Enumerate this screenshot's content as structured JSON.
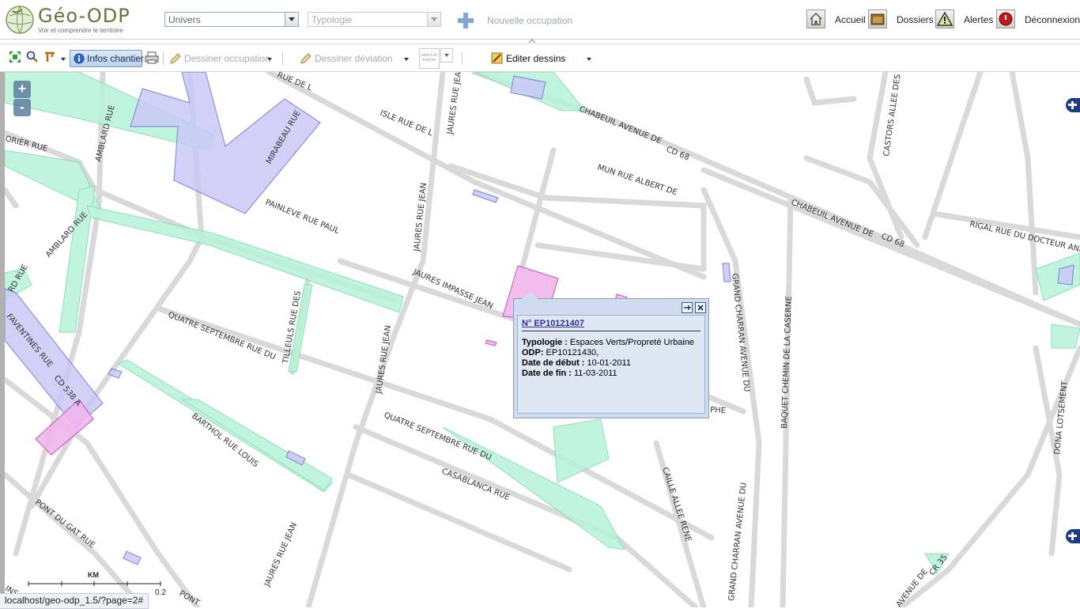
{
  "header": {
    "logo_name": "Géo-ODP",
    "logo_tagline": "Voir et comprendre le territoire",
    "univers_select": "Univers",
    "typologie_select": "Typologie",
    "new_occupation": "Nouvelle occupation",
    "nav": [
      {
        "label": "Accueil",
        "icon": "home-icon"
      },
      {
        "label": "Dossiers",
        "icon": "folder-icon"
      },
      {
        "label": "Alertes",
        "icon": "alert-icon"
      },
      {
        "label": "Déconnexion",
        "icon": "power-icon"
      }
    ]
  },
  "toolbar": {
    "infos_chantier": "Infos chantier",
    "dessiner_occupation": "Dessiner occupation",
    "dessiner_deviation": "Dessiner déviation",
    "select_line": "select un tronçon",
    "editer_dessins": "Editer dessins"
  },
  "map": {
    "zoom_in": "+",
    "zoom_out": "-",
    "street_labels": [
      "RUE DE L",
      "ISLE RUE DE L",
      "JAURES RUE JEAN",
      "CHABEUIL AVENUE DE",
      "CD 68",
      "MUN RUE ALBERT DE",
      "CASTORS ALLEE DES",
      "CHABEUIL AVENUE DE",
      "CD 68",
      "RIGAL RUE DU DOCTEUR AND",
      "ORIER RUE",
      "AMBLARD RUE",
      "MIRABEAU RUE",
      "JAURES RUE JEAN",
      "PAINLEVE RUE PAUL",
      "AMBLARD RUE",
      "RD RUE",
      "JAURES IMPASSE JEAN",
      "GRAND CHARRAN AVENUE DU",
      "BAQUET CHEMIN DE LA CASERNE",
      "FAVENTINES RUE",
      "CD 538 A",
      "TILLEULS RUE DES",
      "QUATRE SEPTEMBRE RUE DU",
      "JAURES RUE JEAN",
      "DONA LOTSEMENT",
      "BARTHOL RUE LOUIS",
      "QUATRE SEPTEMBRE RUE DU",
      "CASABLANCA RUE",
      "CAILLE ALLEE RENE",
      "GRAND CHARRAN AVENUE DU",
      "PONT DU GAT RUE",
      "JAURES RUE JEAN",
      "AVENUE DE",
      "CR 35",
      "INS RU",
      "PONT",
      "PHE"
    ],
    "scale_unit": "KM",
    "scale_max": "0.2"
  },
  "popup": {
    "title": "N° EP10121407",
    "typologie_label": "Typologie :",
    "typologie_value": " Espaces Verts/Propreté Urbaine",
    "odp_label": "ODP:",
    "odp_value": " EP10121430,",
    "debut_label": "Date de début :",
    "debut_value": " 10-01-2011",
    "fin_label": "Date de fin :",
    "fin_value": " 11-03-2011"
  },
  "status_bar": "localhost/geo-odp_1.5/?page=2#"
}
